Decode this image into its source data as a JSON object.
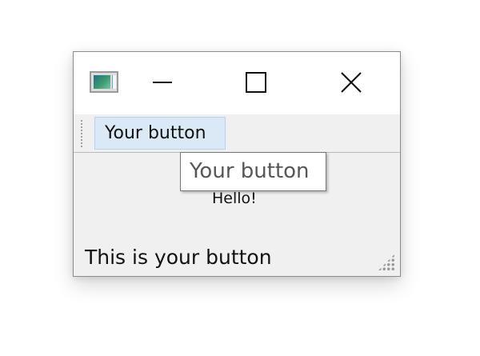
{
  "window": {
    "title_icon": "app-window-icon",
    "controls": {
      "minimize_icon": "minimize-icon",
      "maximize_icon": "maximize-icon",
      "close_icon": "close-icon"
    }
  },
  "toolbar": {
    "button_label": "Your button",
    "grip_icon": "toolbar-grip-icon"
  },
  "tooltip": {
    "text": "Your button"
  },
  "content": {
    "label": "Hello!"
  },
  "statusbar": {
    "text": "This is your button",
    "size_grip_icon": "size-grip-icon"
  },
  "colors": {
    "window_bg": "#f0f0f0",
    "titlebar_bg": "#ffffff",
    "toolbar_button_highlight": "#dbe9f7",
    "toolbar_button_border": "#b5d3ee",
    "tooltip_text": "#575757"
  }
}
